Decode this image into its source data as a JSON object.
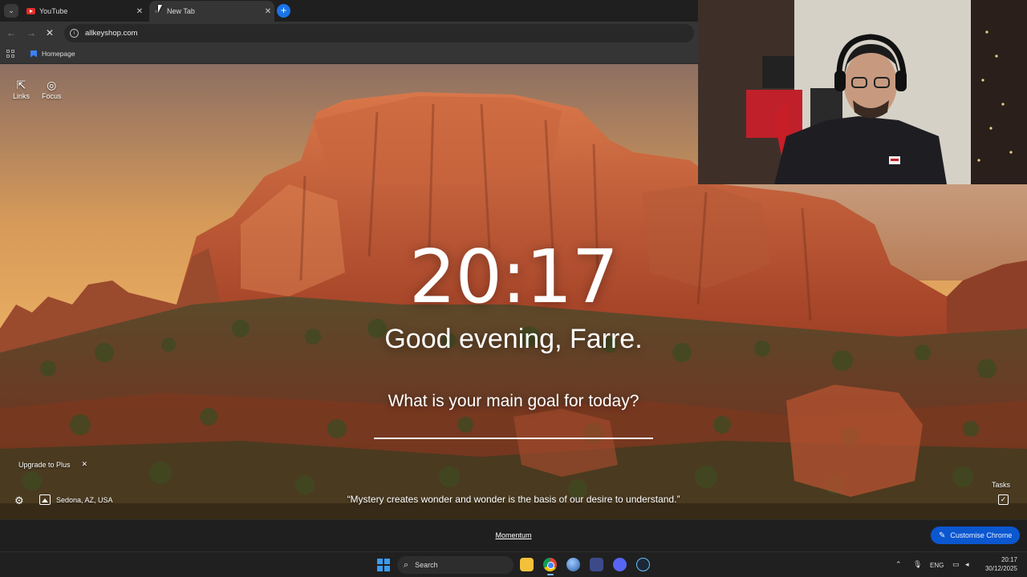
{
  "tabs": [
    {
      "label": "YouTube",
      "icon": "youtube-icon",
      "active": false
    },
    {
      "label": "New Tab",
      "icon": "new-tab-icon",
      "active": true
    }
  ],
  "omnibox": {
    "url": "allkeyshop.com"
  },
  "bookmarks": [
    {
      "label": "Homepage"
    }
  ],
  "momentum": {
    "top_links": [
      {
        "label": "Links",
        "icon": "external-link-icon"
      },
      {
        "label": "Focus",
        "icon": "focus-icon"
      }
    ],
    "clock": "20:17",
    "greeting": "Good evening, Farre.",
    "goal_question": "What is your main goal for today?",
    "goal_value": "",
    "upgrade_label": "Upgrade to Plus",
    "location": "Sedona, AZ, USA",
    "quote": "“Mystery creates wonder and wonder is the basis of our desire to understand.”",
    "tasks_label": "Tasks"
  },
  "ntp_footer": {
    "attribution_link": "Momentum",
    "customise_label": "Customise Chrome"
  },
  "taskbar": {
    "search_label": "Search",
    "apps": [
      "file-explorer-icon",
      "chrome-icon",
      "browser-icon",
      "app-tile-icon",
      "discord-icon",
      "steam-icon"
    ],
    "language": "ENG",
    "time": "20:17",
    "date": "30/12/2025"
  },
  "colors": {
    "accent_blue": "#0b57d0",
    "tab_strip": "#1f1f1f",
    "toolbar": "#353535",
    "youtube_red": "#e52d27"
  }
}
